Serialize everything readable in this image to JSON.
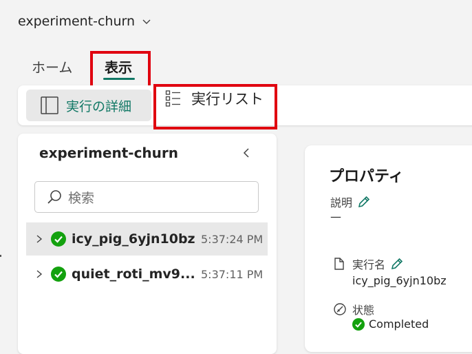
{
  "header": {
    "experiment_name": "experiment-churn"
  },
  "tabs": {
    "home": "ホーム",
    "view": "表示"
  },
  "toolbar": {
    "run_details": "実行の詳細",
    "run_list": "実行リスト"
  },
  "left_panel": {
    "title": "experiment-churn",
    "search_placeholder": "検索",
    "runs": [
      {
        "name": "icy_pig_6yjn10bz",
        "time": "5:37:24 PM",
        "status": "completed",
        "selected": true
      },
      {
        "name": "quiet_roti_mv9...",
        "time": "5:37:11 PM",
        "status": "completed",
        "selected": false
      }
    ]
  },
  "properties": {
    "title": "プロパティ",
    "description_label": "説明",
    "description_value": "—",
    "run_name_label": "実行名",
    "run_name_value": "icy_pig_6yjn10bz",
    "status_label": "状態",
    "status_value": "Completed"
  },
  "colors": {
    "accent": "#117865",
    "success": "#13a10e",
    "highlight": "#e0000f"
  },
  "icons": [
    "chevron-down-icon",
    "panel-icon",
    "list-icon",
    "chevron-left-icon",
    "search-icon",
    "chevron-right-icon",
    "check-circle-icon",
    "pencil-icon",
    "document-icon",
    "status-icon"
  ]
}
